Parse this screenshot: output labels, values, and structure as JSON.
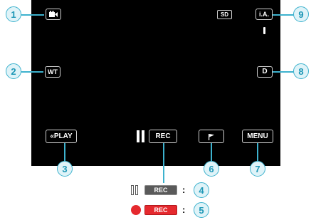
{
  "screen": {
    "sd_label": "SD",
    "ia_label": "i.A.",
    "wt_label": "WT",
    "d_label": "D",
    "play_label": "«PLAY",
    "rec_label": "REC",
    "menu_label": "MENU"
  },
  "callouts": [
    "1",
    "2",
    "3",
    "4",
    "5",
    "6",
    "7",
    "8",
    "9"
  ],
  "legend": [
    {
      "icon": "pause-icon",
      "label": "REC",
      "separator": ":"
    },
    {
      "icon": "record-dot-icon",
      "label": "REC",
      "separator": ":"
    }
  ],
  "colors": {
    "screen_bg": "#000000",
    "callout": "#3db2ce",
    "record_red": "#e5292e"
  }
}
